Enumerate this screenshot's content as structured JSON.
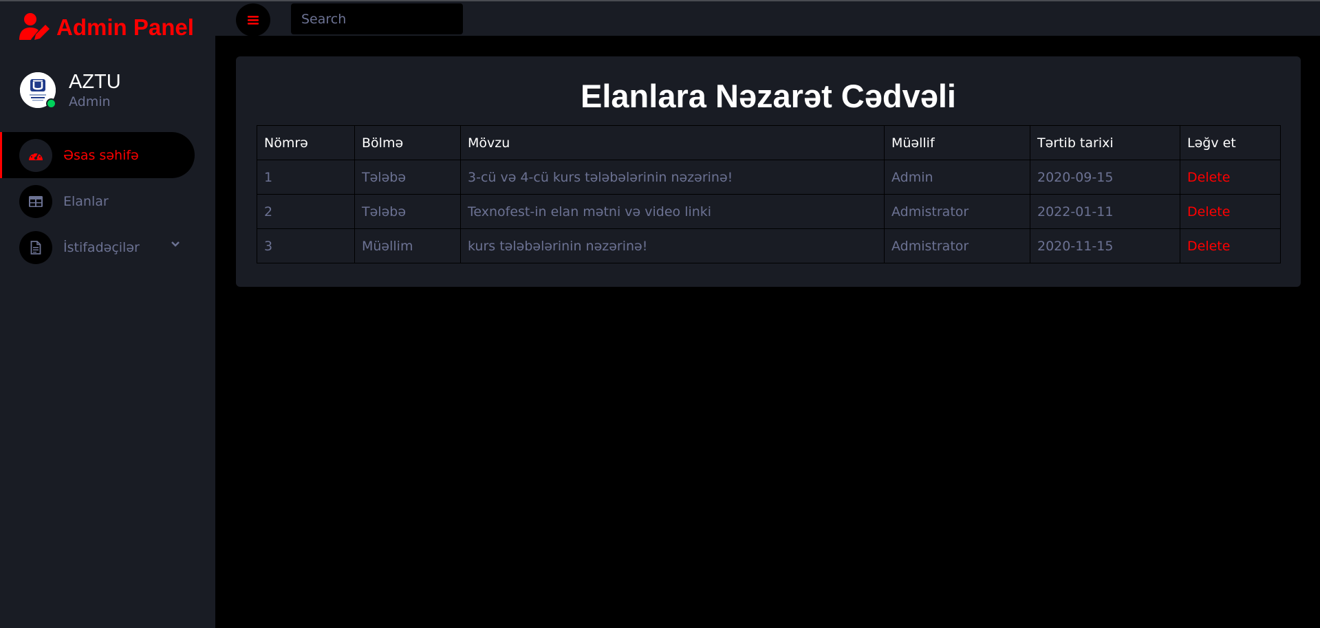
{
  "brand": {
    "title": "Admin Panel",
    "accent": "#ff0000"
  },
  "profile": {
    "name": "AZTU",
    "role": "Admin",
    "status": "online"
  },
  "sidebar": {
    "items": [
      {
        "label": "Əsas səhifə",
        "icon": "speedometer-icon",
        "active": true
      },
      {
        "label": "Elanlar",
        "icon": "table-icon",
        "active": false
      },
      {
        "label": "İstifadəçilər",
        "icon": "document-icon",
        "active": false,
        "expandable": true
      }
    ]
  },
  "topbar": {
    "menu_icon": "hamburger-icon",
    "search_placeholder": "Search"
  },
  "main": {
    "title": "Elanlara Nəzarət Cədvəli",
    "table": {
      "headers": [
        "Nömrə",
        "Bölmə",
        "Mövzu",
        "Müəllif",
        "Tərtib tarixi",
        "Ləğv et"
      ],
      "rows": [
        [
          "1",
          "Tələbə",
          "3-cü və 4-cü kurs tələbələrinin nəzərinə!",
          "Admin",
          "2020-09-15",
          "Delete"
        ],
        [
          "2",
          "Tələbə",
          "Texnofest-in elan mətni və video linki",
          "Admistrator",
          "2022-01-11",
          "Delete"
        ],
        [
          "3",
          "Müəllim",
          "kurs tələbələrinin nəzərinə!",
          "Admistrator",
          "2020-11-15",
          "Delete"
        ]
      ]
    }
  },
  "colors": {
    "sidebar_bg": "#191c24",
    "content_bg": "#000000",
    "muted_text": "#6c7293",
    "accent": "#ff0000",
    "online": "#00d25b"
  }
}
